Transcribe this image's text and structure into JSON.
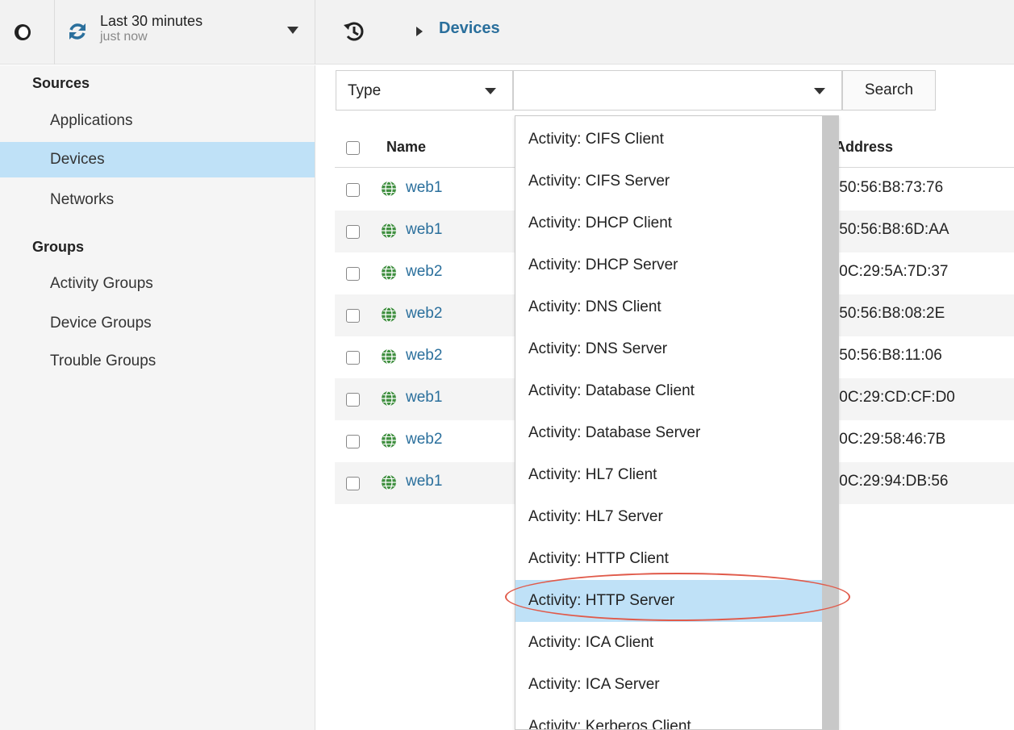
{
  "topbar": {
    "time_range": "Last 30 minutes",
    "time_updated": "just now",
    "breadcrumb": "Devices"
  },
  "sidebar": {
    "sources_heading": "Sources",
    "sources": [
      "Applications",
      "Devices",
      "Networks"
    ],
    "groups_heading": "Groups",
    "groups": [
      "Activity Groups",
      "Device Groups",
      "Trouble Groups"
    ],
    "active_item": "Devices"
  },
  "filter": {
    "type_value": "Type",
    "search_label": "Search"
  },
  "table": {
    "col_name": "Name",
    "col_address": "Address",
    "rows": [
      {
        "name": "web1",
        "mac": ":50:56:B8:73:76"
      },
      {
        "name": "web1",
        "mac": ":50:56:B8:6D:AA"
      },
      {
        "name": "web2",
        "mac": ":0C:29:5A:7D:37"
      },
      {
        "name": "web2",
        "mac": ":50:56:B8:08:2E"
      },
      {
        "name": "web2",
        "mac": ":50:56:B8:11:06"
      },
      {
        "name": "web1",
        "mac": ":0C:29:CD:CF:D0"
      },
      {
        "name": "web2",
        "mac": ":0C:29:58:46:7B"
      },
      {
        "name": "web1",
        "mac": ":0C:29:94:DB:56"
      }
    ]
  },
  "dropdown": {
    "options": [
      "Activity: CIFS Client",
      "Activity: CIFS Server",
      "Activity: DHCP Client",
      "Activity: DHCP Server",
      "Activity: DNS Client",
      "Activity: DNS Server",
      "Activity: Database Client",
      "Activity: Database Server",
      "Activity: HL7 Client",
      "Activity: HL7 Server",
      "Activity: HTTP Client",
      "Activity: HTTP Server",
      "Activity: ICA Client",
      "Activity: ICA Server",
      "Activity: Kerberos Client"
    ],
    "highlighted": "Activity: HTTP Server"
  },
  "colors": {
    "accent_link": "#2a6f9c",
    "selection": "#bfe1f7",
    "annotation_ring": "#e05a4a"
  }
}
